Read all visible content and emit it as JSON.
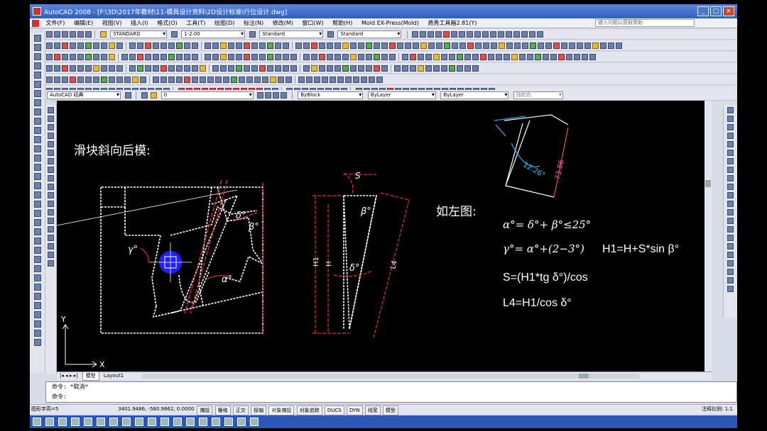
{
  "window": {
    "title": "AutoCAD 2008 - [F:\\3D\\2017年教材\\11-模具设计资料\\2D设计标准\\行位设计.dwg]",
    "min": "_",
    "max": "□",
    "close": "×"
  },
  "menu": {
    "items": [
      "文件(F)",
      "编辑(E)",
      "视图(V)",
      "插入(I)",
      "格式(O)",
      "工具(T)",
      "绘图(D)",
      "标注(N)",
      "修改(M)",
      "窗口(W)",
      "帮助(H)",
      "Mold EX-Press(Mold)",
      "燕秀工具箱2.81(Y)"
    ],
    "help_search": "键入问题以获取帮助"
  },
  "toolbar": {
    "textstyle": "STANDARD",
    "dimscale": "1-2.00",
    "dimstyle": "Standard",
    "tablestyle": "Standard",
    "workspace": "AutoCAD 经典",
    "layer": "0",
    "color": "ByBlock",
    "linetype": "ByLayer",
    "lineweight": "ByLayer",
    "plotstyle": "随颜色"
  },
  "drawing": {
    "heading": "滑块斜向后模:",
    "note": "如左图:",
    "formula1": "α°= δ°+ β°≤25°",
    "formula2": "γ°= α°+(2−3°)",
    "formula3": "H1=H+S*sin β°",
    "formula4": "S=(H1*tg δ°)/cos",
    "formula5": "L4=H1/cos δ°",
    "dim_s": "S",
    "dim_beta": "β°",
    "dim_delta": "δ°",
    "dim_alpha": "α°",
    "dim_gamma": "γ°",
    "dim_h1": "H1",
    "dim_h": "H",
    "dim_l4": "L4",
    "dim_angle": "12.26°",
    "dim_len": "73.86",
    "axis_y": "Y",
    "axis_x": "X",
    "colors": {
      "white": "#ffffff",
      "red": "#e03030",
      "blue": "#2020ff",
      "cyan": "#40c0ff",
      "pink": "#ff60a0"
    }
  },
  "tabs": {
    "nav": "|◂ ◂ ▸ ▸|",
    "model": "模型",
    "layout1": "Layout1"
  },
  "command": {
    "line1": "命令: *取消*",
    "line2": "命令:"
  },
  "status": {
    "font_height": "图形字高=5",
    "coords": "3401.9486, -580.9662, 0.0000",
    "buttons": [
      "捕捉",
      "栅格",
      "正交",
      "极轴",
      "对象捕捉",
      "对象追踪",
      "DUCS",
      "DYN",
      "线宽",
      "模型"
    ],
    "anno_scale": "注释比例: 1:1"
  }
}
